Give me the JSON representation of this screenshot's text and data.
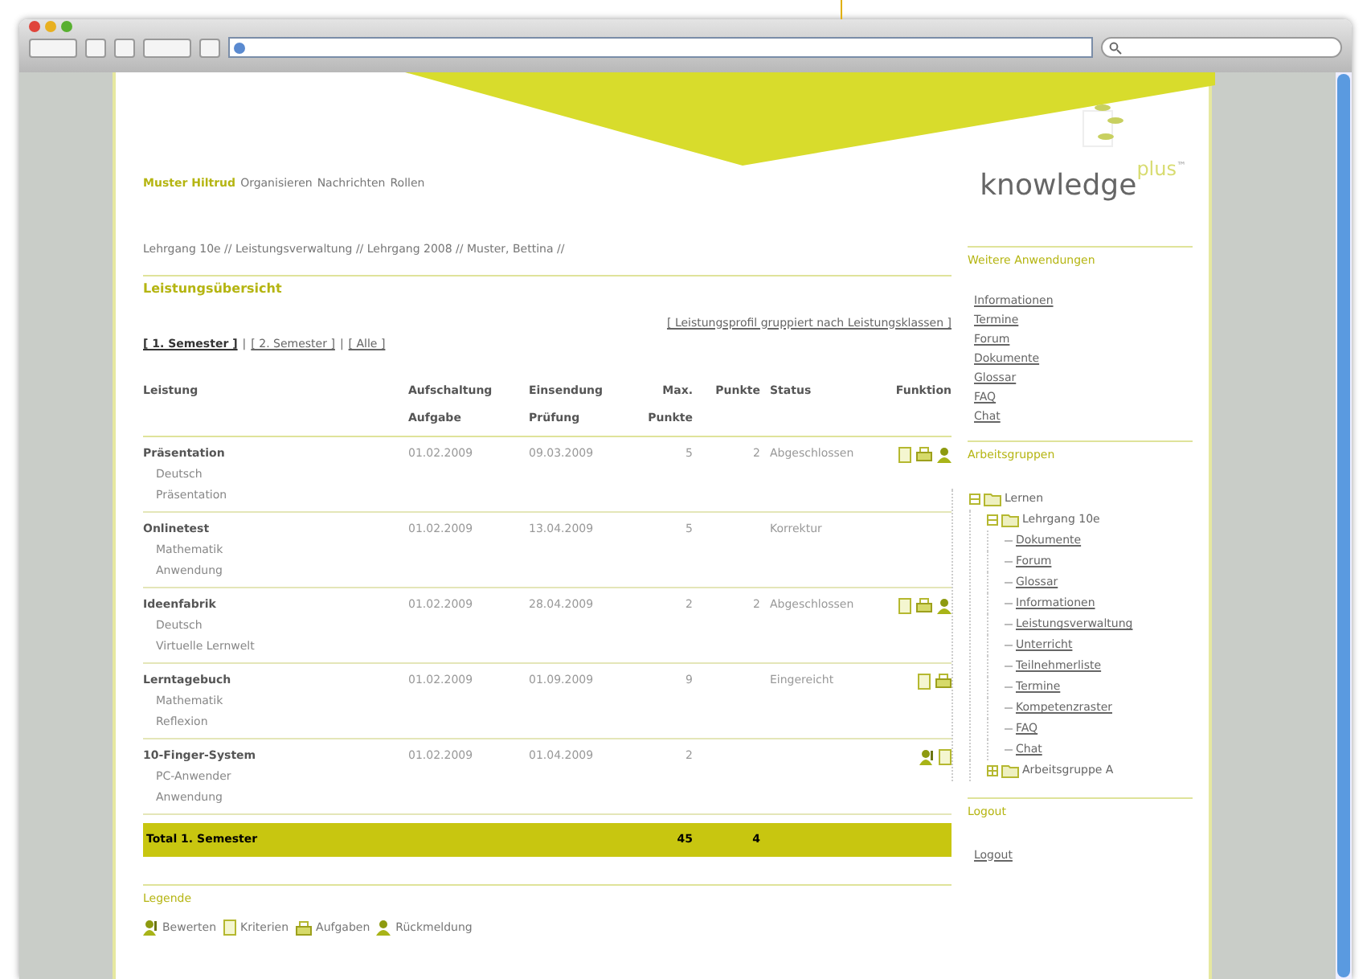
{
  "header": {
    "user": "Muster Hiltrud",
    "menu": [
      "Organisieren",
      "Nachrichten",
      "Rollen"
    ],
    "logo": {
      "main": "knowledge",
      "sup": "plus",
      "tm": "™"
    }
  },
  "breadcrumb": "Lehrgang 10e // Leistungsverwaltung // Lehrgang 2008 // Muster, Bettina //",
  "section_title": "Leistungsübersicht",
  "group_link": "[ Leistungsprofil gruppiert nach Leistungsklassen ]",
  "filter_separator": "|",
  "filters": [
    {
      "label": "[ 1. Semester ]",
      "selected": true
    },
    {
      "label": "[ 2. Semester ]",
      "selected": false
    },
    {
      "label": "[ Alle ]",
      "selected": false
    }
  ],
  "table": {
    "columns": [
      "Leistung",
      "Aufschaltung Aufgabe",
      "Einsendung Prüfung",
      "Max. Punkte",
      "Punkte",
      "Status",
      "Funktion"
    ],
    "rows": [
      {
        "name": "Präsentation",
        "subject": "Deutsch",
        "category": "Präsentation",
        "start": "01.02.2009",
        "due": "09.03.2009",
        "max": "5",
        "points": "2",
        "status": "Abgeschlossen",
        "functions": [
          {
            "kind": "criteria"
          },
          {
            "kind": "tasks"
          },
          {
            "kind": "feedback"
          }
        ]
      },
      {
        "name": "Onlinetest",
        "subject": "Mathematik",
        "category": "Anwendung",
        "start": "01.02.2009",
        "due": "13.04.2009",
        "max": "5",
        "points": "",
        "status": "Korrektur",
        "functions": []
      },
      {
        "name": "Ideenfabrik",
        "subject": "Deutsch",
        "category": "Virtuelle Lernwelt",
        "start": "01.02.2009",
        "due": "28.04.2009",
        "max": "2",
        "points": "2",
        "status": "Abgeschlossen",
        "functions": [
          {
            "kind": "criteria"
          },
          {
            "kind": "tasks"
          },
          {
            "kind": "feedback"
          }
        ]
      },
      {
        "name": "Lerntagebuch",
        "subject": "Mathematik",
        "category": "Reflexion",
        "start": "01.02.2009",
        "due": "01.09.2009",
        "max": "9",
        "points": "",
        "status": "Eingereicht",
        "functions": [
          {
            "kind": "criteria"
          },
          {
            "kind": "tasks"
          }
        ]
      },
      {
        "name": "10-Finger-System",
        "subject": "PC-Anwender",
        "category": "Anwendung",
        "start": "01.02.2009",
        "due": "01.04.2009",
        "max": "2",
        "points": "",
        "status": "",
        "functions": [
          {
            "kind": "evaluate"
          },
          {
            "kind": "criteria"
          }
        ]
      }
    ],
    "total": {
      "label": "Total 1. Semester",
      "max": "45",
      "points": "4"
    }
  },
  "legend": {
    "title": "Legende",
    "items": [
      {
        "kind": "evaluate",
        "label": "Bewerten"
      },
      {
        "kind": "criteria",
        "label": "Kriterien"
      },
      {
        "kind": "tasks",
        "label": "Aufgaben"
      },
      {
        "kind": "feedback",
        "label": "Rückmeldung"
      }
    ]
  },
  "sidebar": {
    "apps": {
      "title": "Weitere Anwendungen",
      "items": [
        "Informationen",
        "Termine",
        "Forum",
        "Dokumente",
        "Glossar",
        "FAQ",
        "Chat"
      ]
    },
    "groups": {
      "title": "Arbeitsgruppen",
      "tree": [
        {
          "label": "Lernen",
          "expanded": true,
          "children": [
            {
              "label": "Lehrgang 10e",
              "expanded": true,
              "children": [
                {
                  "label": "Dokumente"
                },
                {
                  "label": "Forum"
                },
                {
                  "label": "Glossar"
                },
                {
                  "label": "Informationen"
                },
                {
                  "label": "Leistungsverwaltung"
                },
                {
                  "label": "Unterricht"
                },
                {
                  "label": "Teilnehmerliste"
                },
                {
                  "label": "Termine"
                },
                {
                  "label": "Kompetenzraster"
                },
                {
                  "label": "FAQ"
                },
                {
                  "label": "Chat"
                }
              ]
            },
            {
              "label": "Arbeitsgruppe A",
              "expanded": false
            }
          ]
        }
      ]
    },
    "logout": {
      "title": "Logout",
      "link": "Logout"
    }
  }
}
